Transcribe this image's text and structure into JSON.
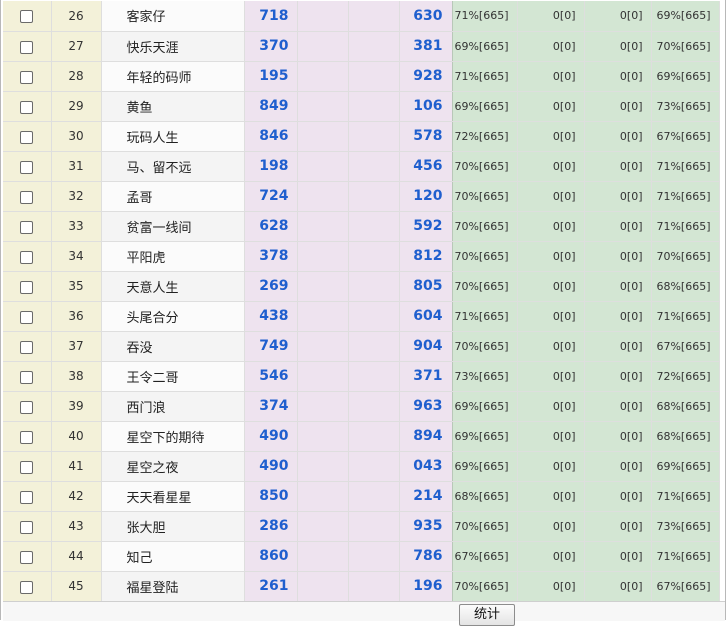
{
  "rows": [
    {
      "num": "26",
      "name": "客家仔",
      "a": "718",
      "b": "630",
      "g1": "71%[665]",
      "g2": "0[0]",
      "g3": "0[0]",
      "g4": "69%[665]"
    },
    {
      "num": "27",
      "name": "快乐天涯",
      "a": "370",
      "b": "381",
      "g1": "69%[665]",
      "g2": "0[0]",
      "g3": "0[0]",
      "g4": "70%[665]"
    },
    {
      "num": "28",
      "name": "年轻的码师",
      "a": "195",
      "b": "928",
      "g1": "71%[665]",
      "g2": "0[0]",
      "g3": "0[0]",
      "g4": "69%[665]"
    },
    {
      "num": "29",
      "name": "黄鱼",
      "a": "849",
      "b": "106",
      "g1": "69%[665]",
      "g2": "0[0]",
      "g3": "0[0]",
      "g4": "73%[665]"
    },
    {
      "num": "30",
      "name": "玩码人生",
      "a": "846",
      "b": "578",
      "g1": "72%[665]",
      "g2": "0[0]",
      "g3": "0[0]",
      "g4": "67%[665]"
    },
    {
      "num": "31",
      "name": "马、留不远",
      "a": "198",
      "b": "456",
      "g1": "70%[665]",
      "g2": "0[0]",
      "g3": "0[0]",
      "g4": "71%[665]"
    },
    {
      "num": "32",
      "name": "孟哥",
      "a": "724",
      "b": "120",
      "g1": "70%[665]",
      "g2": "0[0]",
      "g3": "0[0]",
      "g4": "71%[665]"
    },
    {
      "num": "33",
      "name": "贫富一线间",
      "a": "628",
      "b": "592",
      "g1": "70%[665]",
      "g2": "0[0]",
      "g3": "0[0]",
      "g4": "71%[665]"
    },
    {
      "num": "34",
      "name": "平阳虎",
      "a": "378",
      "b": "812",
      "g1": "70%[665]",
      "g2": "0[0]",
      "g3": "0[0]",
      "g4": "70%[665]"
    },
    {
      "num": "35",
      "name": "天意人生",
      "a": "269",
      "b": "805",
      "g1": "70%[665]",
      "g2": "0[0]",
      "g3": "0[0]",
      "g4": "68%[665]"
    },
    {
      "num": "36",
      "name": "头尾合分",
      "a": "438",
      "b": "604",
      "g1": "71%[665]",
      "g2": "0[0]",
      "g3": "0[0]",
      "g4": "71%[665]"
    },
    {
      "num": "37",
      "name": "吞没",
      "a": "749",
      "b": "904",
      "g1": "70%[665]",
      "g2": "0[0]",
      "g3": "0[0]",
      "g4": "67%[665]"
    },
    {
      "num": "38",
      "name": "王令二哥",
      "a": "546",
      "b": "371",
      "g1": "73%[665]",
      "g2": "0[0]",
      "g3": "0[0]",
      "g4": "72%[665]"
    },
    {
      "num": "39",
      "name": "西门浪",
      "a": "374",
      "b": "963",
      "g1": "69%[665]",
      "g2": "0[0]",
      "g3": "0[0]",
      "g4": "68%[665]"
    },
    {
      "num": "40",
      "name": "星空下的期待",
      "a": "490",
      "b": "894",
      "g1": "69%[665]",
      "g2": "0[0]",
      "g3": "0[0]",
      "g4": "68%[665]"
    },
    {
      "num": "41",
      "name": "星空之夜",
      "a": "490",
      "b": "043",
      "g1": "69%[665]",
      "g2": "0[0]",
      "g3": "0[0]",
      "g4": "69%[665]"
    },
    {
      "num": "42",
      "name": "天天看星星",
      "a": "850",
      "b": "214",
      "g1": "68%[665]",
      "g2": "0[0]",
      "g3": "0[0]",
      "g4": "71%[665]"
    },
    {
      "num": "43",
      "name": "张大胆",
      "a": "286",
      "b": "935",
      "g1": "70%[665]",
      "g2": "0[0]",
      "g3": "0[0]",
      "g4": "73%[665]"
    },
    {
      "num": "44",
      "name": "知己",
      "a": "860",
      "b": "786",
      "g1": "67%[665]",
      "g2": "0[0]",
      "g3": "0[0]",
      "g4": "71%[665]"
    },
    {
      "num": "45",
      "name": "福星登陆",
      "a": "261",
      "b": "196",
      "g1": "70%[665]",
      "g2": "0[0]",
      "g3": "0[0]",
      "g4": "67%[665]"
    }
  ],
  "footer": {
    "stat_button_label": "统计"
  },
  "colors": {
    "number_blue": "#1f5fce",
    "yellow_column": "#f3f1d9",
    "pink_column": "#eee3ef",
    "green_column": "#d3e6d3"
  }
}
